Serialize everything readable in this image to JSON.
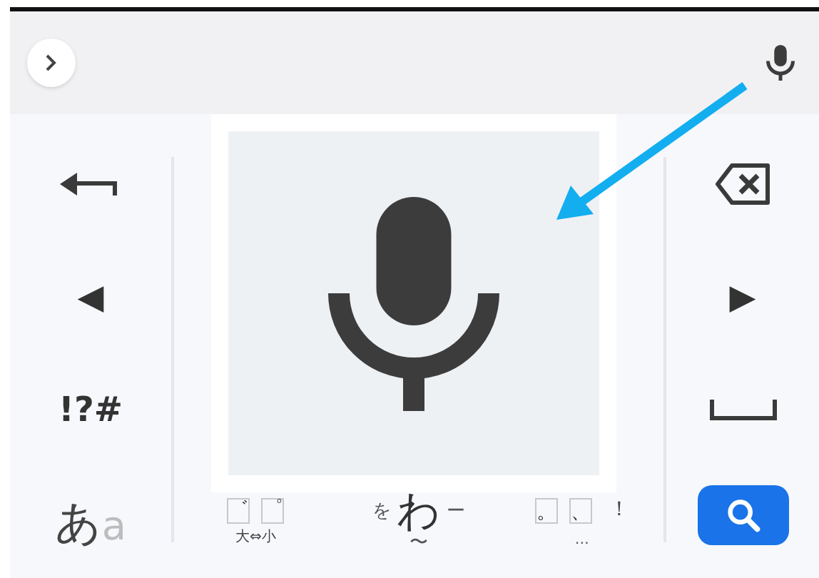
{
  "left_keys": [
    {
      "kind": "enter"
    },
    {
      "kind": "text",
      "label": "◀"
    },
    {
      "kind": "text",
      "label": "!?#"
    },
    {
      "kind": "mode",
      "label": "あ",
      "secondary": "a"
    }
  ],
  "bottom_keys": [
    {
      "kind": "dakuten",
      "marks": [
        "゛",
        "゜"
      ],
      "caption": "大⇔小"
    },
    {
      "kind": "flick",
      "main": "わ",
      "left": "を",
      "right": "ー",
      "bottom": "〜"
    },
    {
      "kind": "punct",
      "marks": [
        "。",
        "、"
      ],
      "right": "！",
      "bottom": "…"
    }
  ],
  "right_keys": [
    {
      "kind": "backspace"
    },
    {
      "kind": "text",
      "label": "▶"
    },
    {
      "kind": "space"
    },
    {
      "kind": "search"
    }
  ]
}
